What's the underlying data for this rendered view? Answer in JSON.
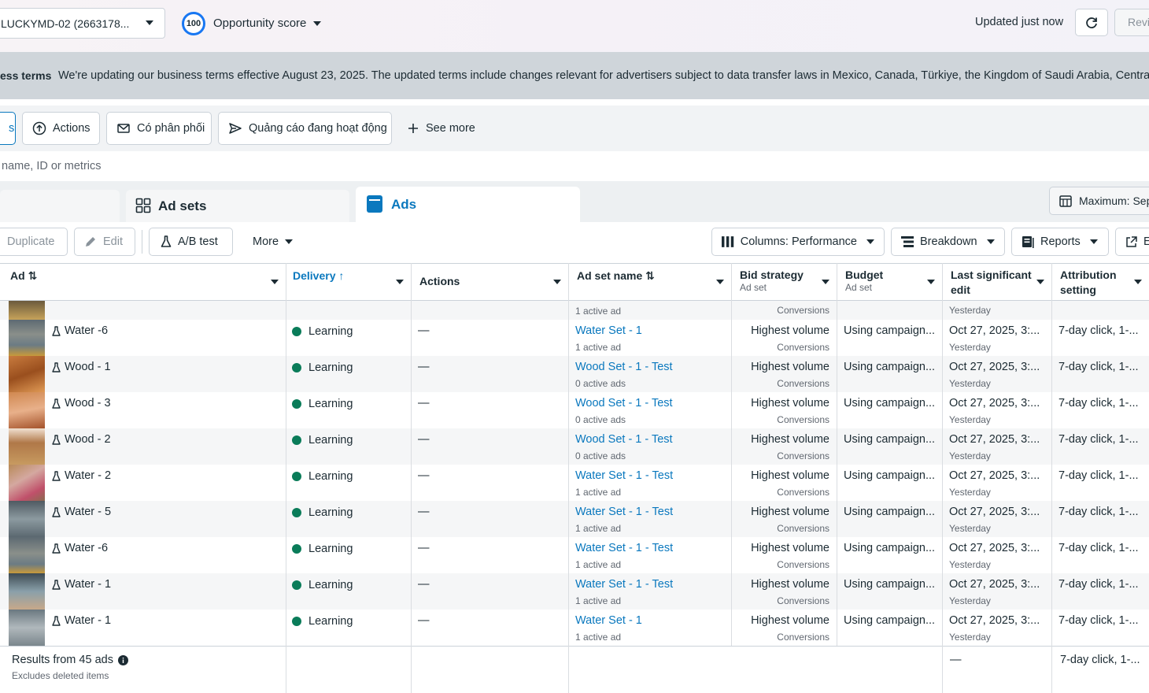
{
  "topbar": {
    "account": "LUCKYMD-02 (2663178...",
    "score_value": "100",
    "score_label": "Opportunity score",
    "updated": "Updated just now",
    "review": "Revi"
  },
  "banner": {
    "title": "ess terms",
    "text": "We're updating our business terms effective August 23, 2025. The updated terms include changes relevant for advertisers subject to data transfer laws in Mexico, Canada, Türkiye, the Kingdom of Saudi Arabia, Central A"
  },
  "filters": {
    "partial": "s",
    "actions": "Actions",
    "delivered": "Có phân phối",
    "active_ads": "Quảng cáo đang hoạt động",
    "see_more": "See more"
  },
  "search": {
    "placeholder": "name, ID or metrics"
  },
  "tabs": {
    "adsets": "Ad sets",
    "ads": "Ads",
    "max": "Maximum: Sep"
  },
  "toolbar": {
    "duplicate": "Duplicate",
    "edit": "Edit",
    "abtest": "A/B test",
    "more": "More",
    "columns": "Columns: Performance",
    "breakdown": "Breakdown",
    "reports": "Reports",
    "export": "E"
  },
  "headers": {
    "ad": "Ad",
    "delivery": "Delivery",
    "actions": "Actions",
    "adset": "Ad set name",
    "bid": "Bid strategy",
    "bid_sub": "Ad set",
    "budget": "Budget",
    "budget_sub": "Ad set",
    "edit1": "Last significant",
    "edit2": "edit",
    "attr1": "Attribution",
    "attr2": "setting"
  },
  "partial_row": {
    "adset_sub": "1 active ad",
    "bid_sub": "Conversions",
    "edit_sub": "Yesterday"
  },
  "rows": [
    {
      "ad": "Water -6",
      "delivery": "Learning",
      "action": "—",
      "adset": "Water Set - 1",
      "adset_sub": "1 active ad",
      "bid": "Highest volume",
      "bid_sub": "Conversions",
      "budget": "Using campaign...",
      "edit": "Oct 27, 2025, 3:...",
      "edit_sub": "Yesterday",
      "attr": "7-day click, 1-..."
    },
    {
      "ad": "Wood - 1",
      "delivery": "Learning",
      "action": "—",
      "adset": "Wood Set - 1 - Test",
      "adset_sub": "0 active ads",
      "bid": "Highest volume",
      "bid_sub": "Conversions",
      "budget": "Using campaign...",
      "edit": "Oct 27, 2025, 3:...",
      "edit_sub": "Yesterday",
      "attr": "7-day click, 1-..."
    },
    {
      "ad": "Wood - 3",
      "delivery": "Learning",
      "action": "—",
      "adset": "Wood Set - 1 - Test",
      "adset_sub": "0 active ads",
      "bid": "Highest volume",
      "bid_sub": "Conversions",
      "budget": "Using campaign...",
      "edit": "Oct 27, 2025, 3:...",
      "edit_sub": "Yesterday",
      "attr": "7-day click, 1-..."
    },
    {
      "ad": "Wood - 2",
      "delivery": "Learning",
      "action": "—",
      "adset": "Wood Set - 1 - Test",
      "adset_sub": "0 active ads",
      "bid": "Highest volume",
      "bid_sub": "Conversions",
      "budget": "Using campaign...",
      "edit": "Oct 27, 2025, 3:...",
      "edit_sub": "Yesterday",
      "attr": "7-day click, 1-..."
    },
    {
      "ad": "Water - 2",
      "delivery": "Learning",
      "action": "—",
      "adset": "Water Set - 1 - Test",
      "adset_sub": "1 active ad",
      "bid": "Highest volume",
      "bid_sub": "Conversions",
      "budget": "Using campaign...",
      "edit": "Oct 27, 2025, 3:...",
      "edit_sub": "Yesterday",
      "attr": "7-day click, 1-..."
    },
    {
      "ad": "Water - 5",
      "delivery": "Learning",
      "action": "—",
      "adset": "Water Set - 1 - Test",
      "adset_sub": "1 active ad",
      "bid": "Highest volume",
      "bid_sub": "Conversions",
      "budget": "Using campaign...",
      "edit": "Oct 27, 2025, 3:...",
      "edit_sub": "Yesterday",
      "attr": "7-day click, 1-..."
    },
    {
      "ad": "Water -6",
      "delivery": "Learning",
      "action": "—",
      "adset": "Water Set - 1 - Test",
      "adset_sub": "1 active ad",
      "bid": "Highest volume",
      "bid_sub": "Conversions",
      "budget": "Using campaign...",
      "edit": "Oct 27, 2025, 3:...",
      "edit_sub": "Yesterday",
      "attr": "7-day click, 1-..."
    },
    {
      "ad": "Water - 1",
      "delivery": "Learning",
      "action": "—",
      "adset": "Water Set - 1 - Test",
      "adset_sub": "1 active ad",
      "bid": "Highest volume",
      "bid_sub": "Conversions",
      "budget": "Using campaign...",
      "edit": "Oct 27, 2025, 3:...",
      "edit_sub": "Yesterday",
      "attr": "7-day click, 1-..."
    },
    {
      "ad": "Water - 1",
      "delivery": "Learning",
      "action": "—",
      "adset": "Water Set - 1",
      "adset_sub": "1 active ad",
      "bid": "Highest volume",
      "bid_sub": "Conversions",
      "budget": "Using campaign...",
      "edit": "Oct 27, 2025, 3:...",
      "edit_sub": "Yesterday",
      "attr": "7-day click, 1-..."
    }
  ],
  "footer": {
    "results": "Results from 45 ads",
    "excludes": "Excludes deleted items",
    "edit": "—",
    "attr": "7-day click, 1-..."
  },
  "colors": {
    "accent": "#0a78be",
    "learning": "#0a7c59",
    "blue": "#1877f2"
  }
}
